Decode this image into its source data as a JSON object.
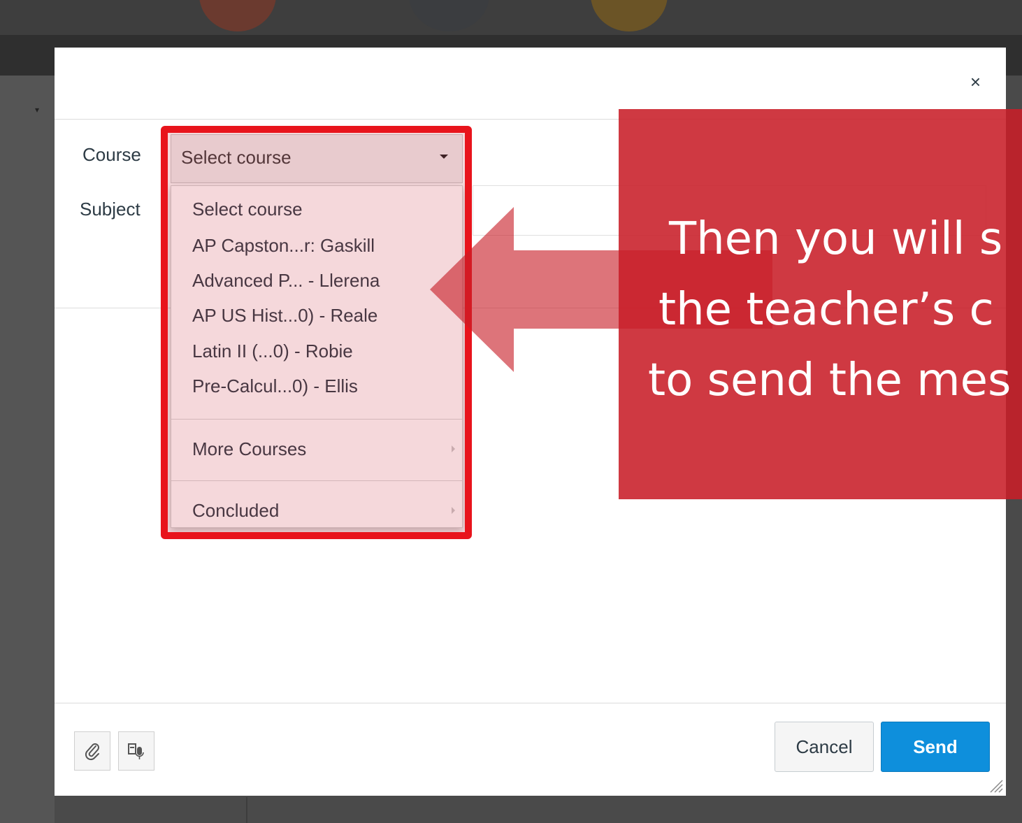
{
  "modal": {
    "close_glyph": "×",
    "course_label": "Course",
    "subject_label": "Subject"
  },
  "course_select": {
    "value": "Select course",
    "options": [
      "Select course",
      "AP Capston...r: Gaskill",
      "Advanced P...  - Llerena",
      "AP US Hist...0) - Reale",
      "Latin II (...0) - Robie",
      "Pre-Calcul...0) - Ellis"
    ],
    "more_courses": "More Courses",
    "concluded": "Concluded"
  },
  "callout": {
    "line1": "Then you will s",
    "line2": "the teacher’s c",
    "line3": "to send the mes"
  },
  "footer": {
    "attach_icon": "paperclip-icon",
    "media_icon": "record-media-icon",
    "cancel_label": "Cancel",
    "send_label": "Send"
  },
  "colors": {
    "send_button": "#0e8fdc",
    "annotation_red": "#e8141c",
    "callout_red": "#c81e28"
  }
}
